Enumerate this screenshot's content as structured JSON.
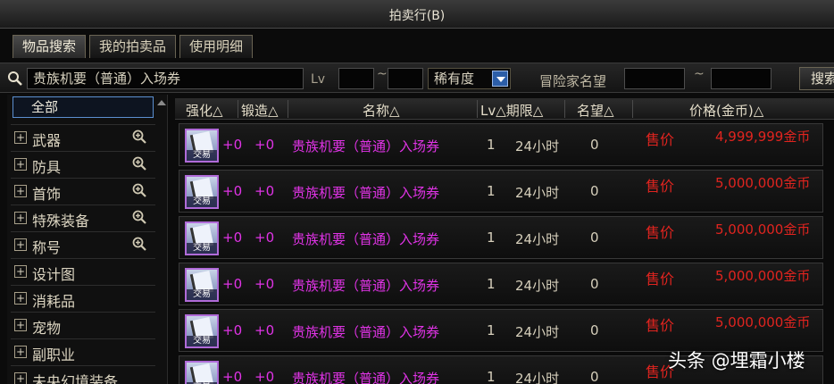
{
  "window": {
    "title": "拍卖行(B)"
  },
  "tabs": [
    {
      "label": "物品搜索"
    },
    {
      "label": "我的拍卖品"
    },
    {
      "label": "使用明细"
    }
  ],
  "search": {
    "query": "贵族机要（普通）入场券",
    "lv_label": "Lv",
    "range_sep": "~",
    "rarity_value": "稀有度",
    "seller_label": "冒险家名望",
    "button_label": "搜索"
  },
  "sidebar": {
    "all_label": "全部",
    "items": [
      {
        "label": "武器",
        "zoom": true
      },
      {
        "label": "防具",
        "zoom": true
      },
      {
        "label": "首饰",
        "zoom": true
      },
      {
        "label": "特殊装备",
        "zoom": true
      },
      {
        "label": "称号",
        "zoom": true
      },
      {
        "label": "设计图",
        "zoom": false
      },
      {
        "label": "消耗品",
        "zoom": false
      },
      {
        "label": "宠物",
        "zoom": false
      },
      {
        "label": "副职业",
        "zoom": false
      },
      {
        "label": "未央幻境装备",
        "zoom": false
      }
    ]
  },
  "table": {
    "headers": {
      "enhance": "强化△",
      "forge": "锻造△",
      "name": "名称△",
      "lv_limit": "Lv△期限△",
      "fame": "名望△",
      "price": "价格(金币)△"
    },
    "icon_tag": "交易",
    "rows": [
      {
        "enhance": "+0",
        "forge": "+0",
        "name": "贵族机要（普通）入场券",
        "lv": "1",
        "limit": "24小时",
        "fame": "0",
        "price_label": "售价",
        "price": "4,999,999金币"
      },
      {
        "enhance": "+0",
        "forge": "+0",
        "name": "贵族机要（普通）入场券",
        "lv": "1",
        "limit": "24小时",
        "fame": "0",
        "price_label": "售价",
        "price": "5,000,000金币"
      },
      {
        "enhance": "+0",
        "forge": "+0",
        "name": "贵族机要（普通）入场券",
        "lv": "1",
        "limit": "24小时",
        "fame": "0",
        "price_label": "售价",
        "price": "5,000,000金币"
      },
      {
        "enhance": "+0",
        "forge": "+0",
        "name": "贵族机要（普通）入场券",
        "lv": "1",
        "limit": "24小时",
        "fame": "0",
        "price_label": "售价",
        "price": "5,000,000金币"
      },
      {
        "enhance": "+0",
        "forge": "+0",
        "name": "贵族机要（普通）入场券",
        "lv": "1",
        "limit": "24小时",
        "fame": "0",
        "price_label": "售价",
        "price": "5,000,000金币"
      },
      {
        "enhance": "+0",
        "forge": "+0",
        "name": "贵族机要（普通）入场券",
        "lv": "1",
        "limit": "24小时",
        "fame": "0",
        "price_label": "售价",
        "price": ""
      }
    ]
  },
  "watermark": "头条 @埋霜小楼",
  "colors": {
    "item_name": "#e033e6",
    "price": "#e0241f",
    "selection": "#5b8fd0"
  }
}
